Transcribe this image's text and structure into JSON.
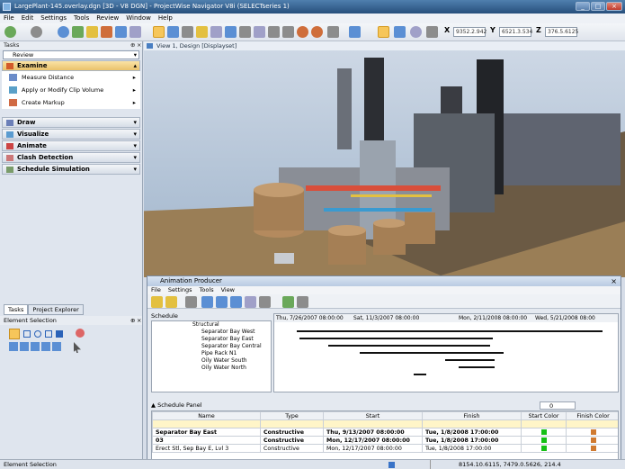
{
  "window": {
    "title": "LargePlant-145.overlay.dgn [3D - V8 DGN] - ProjectWise Navigator V8i (SELECTseries 1)"
  },
  "menu": [
    "File",
    "Edit",
    "Settings",
    "Tools",
    "Review",
    "Window",
    "Help"
  ],
  "coords": {
    "x_label": "X",
    "x_value": "9352.2.942",
    "y_label": "Y",
    "y_value": "6521.3.534",
    "z_label": "Z",
    "z_value": "376.5.6125"
  },
  "tasks": {
    "header": "Tasks",
    "dropdown": "Review",
    "section": "Examine",
    "items": [
      "Measure Distance",
      "Apply or Modify Clip Volume",
      "Create Markup"
    ],
    "groups": [
      "Draw",
      "Visualize",
      "Animate",
      "Clash Detection",
      "Schedule Simulation"
    ]
  },
  "bottom_tabs": [
    "Tasks",
    "Project Explorer"
  ],
  "element_selection": {
    "header": "Element Selection"
  },
  "view": {
    "title": "View 1, Design [Displayset]"
  },
  "animation": {
    "title": "Animation Producer",
    "menu": [
      "File",
      "Settings",
      "Tools",
      "View"
    ],
    "schedule_label": "Schedule",
    "tree": [
      "Structural",
      "Separator Bay West",
      "Separator Bay East",
      "Separator Bay Central",
      "Pipe Rack N1",
      "Oily Water South",
      "Oily Water North"
    ],
    "dates": [
      "Thu, 7/26/2007 08:00:00",
      "Sat, 11/3/2007 08:00:00",
      "Mon, 2/11/2008 08:00:00",
      "Wed, 5/21/2008 08:00"
    ],
    "panel_label": "Schedule Panel",
    "counter": "0",
    "columns": [
      "Name",
      "Type",
      "Start",
      "Finish",
      "Start Color",
      "Finish Color"
    ],
    "rows": [
      {
        "name": "Separator Bay East",
        "type": "Constructive",
        "start": "Thu, 9/13/2007 08:00:00",
        "finish": "Tue, 1/8/2008 17:00:00",
        "bold": true
      },
      {
        "name": "03",
        "type": "Constructive",
        "start": "Mon, 12/17/2007 08:00:00",
        "finish": "Tue, 1/8/2008 17:00:00",
        "bold": true
      },
      {
        "name": "Erect Stl, Sep Bay E, Lvl 3",
        "type": "Constructive",
        "start": "Mon, 12/17/2007 08:00:00",
        "finish": "Tue, 1/8/2008 17:00:00",
        "bold": false
      }
    ]
  },
  "status": {
    "left": "Element Selection",
    "right": "8154.10.6115, 7479.0.5626, 214.4"
  }
}
